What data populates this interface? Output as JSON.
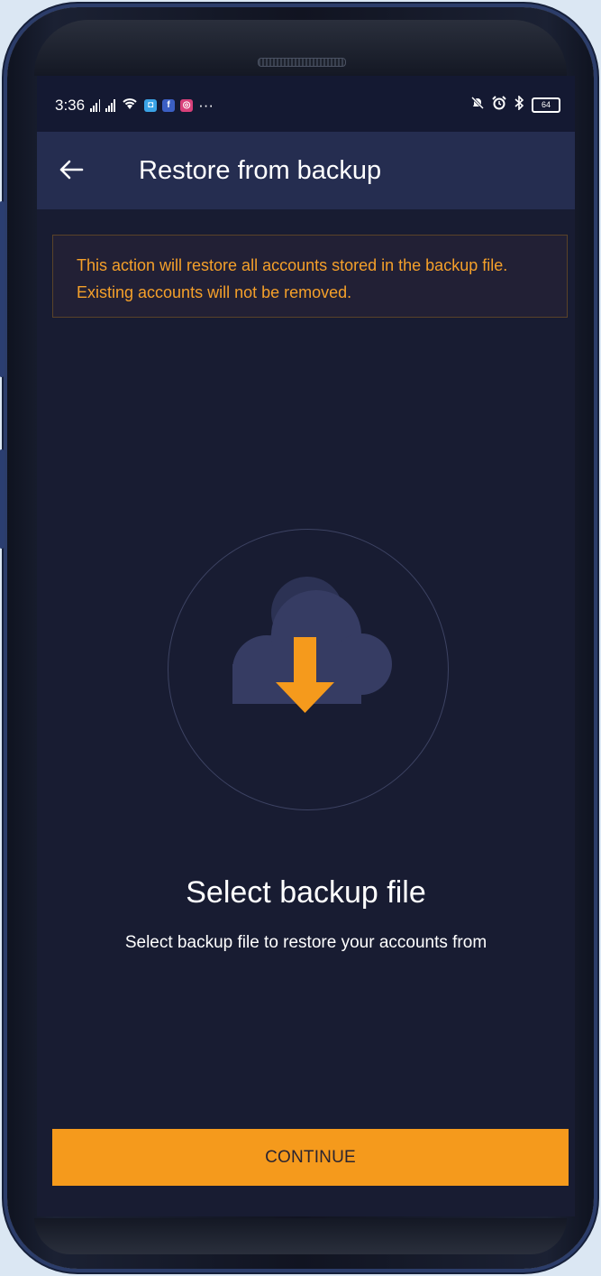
{
  "status_bar": {
    "time": "3:36",
    "more_indicator": "···",
    "battery_level": "64",
    "icons": [
      "signal-icon",
      "signal-icon",
      "wifi-icon",
      "app-notification-icon",
      "facebook-icon",
      "instagram-icon",
      "mute-icon",
      "alarm-icon",
      "bluetooth-icon",
      "battery-icon"
    ]
  },
  "appbar": {
    "title": "Restore from backup",
    "back_icon": "arrow-left-icon"
  },
  "warning": {
    "text": "This action will restore all accounts stored in the backup file. Existing accounts will not be removed."
  },
  "illustration": {
    "icon": "cloud-download-icon",
    "accent": "#f59a1c",
    "cloud_color": "#363c63"
  },
  "content": {
    "title": "Select backup file",
    "subtitle": "Select backup file to restore your accounts from"
  },
  "footer": {
    "continue_label": "CONTINUE"
  },
  "colors": {
    "background": "#181c32",
    "appbar": "#252d50",
    "accent": "#f59a1c",
    "warning_text": "#f5a02a"
  }
}
